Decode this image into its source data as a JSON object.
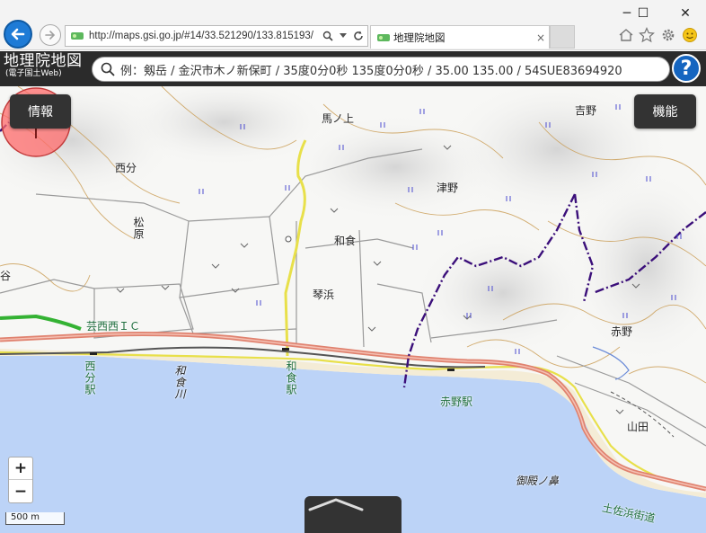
{
  "browser": {
    "address_url": "http://maps.gsi.go.jp/#14/33.521290/133.815193/",
    "tab_title": "地理院地図",
    "tab_close": "×",
    "window_controls": {
      "minimize": "─",
      "maximize": "☐",
      "close": "✕"
    },
    "icons": [
      "back-arrow-icon",
      "forward-arrow-icon",
      "search-icon",
      "dropdown-icon",
      "refresh-icon",
      "home-icon",
      "star-icon",
      "gear-icon",
      "smiley-icon"
    ]
  },
  "header": {
    "logo_main": "地理院地図",
    "logo_sub": "(電子国土Web)",
    "search_placeholder": "例：剱岳 / 金沢市木ノ新保町 / 35度0分0秒 135度0分0秒 / 35.00 135.00 / 54SUE83694920",
    "help_label": "?"
  },
  "map": {
    "info_button": "情報",
    "function_button": "機能",
    "zoom_in": "+",
    "zoom_out": "−",
    "scale_label": "500 m",
    "labels": {
      "umanoue": "馬ノ上",
      "yoshino": "吉野",
      "nishibun": "西分",
      "tsunno": "津野",
      "matsubara": "松原",
      "wajiki": "和食",
      "tani": "谷",
      "kotogahama": "琴浜",
      "geisei_ic": "芸西西ＩＣ",
      "akano": "赤野",
      "nishibun_station": "西分駅",
      "wajiki_river": "和食川",
      "wajiki_station": "和食駅",
      "akano_station": "赤野駅",
      "yamada": "山田",
      "gotenohana": "御殿ノ鼻",
      "tosahama_kaido": "土佐浜街道"
    },
    "colors": {
      "sea": "#bcd3f7",
      "railway": "#555555",
      "expressway": "#e0826f",
      "route_yellow": "#e8e04a",
      "boundary": "#3b0f7a",
      "contour": "#c99a4f",
      "crosshair_fill": "#ff6b6b",
      "ic_green": "#34b233"
    }
  }
}
